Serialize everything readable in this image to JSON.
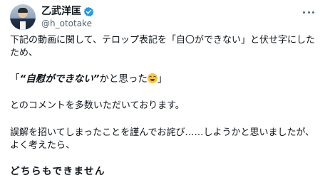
{
  "tweet": {
    "author": {
      "display_name": "乙武洋匡",
      "handle": "@h_ototake",
      "verified": true,
      "verified_color": "#1d9bf0"
    },
    "paragraphs": {
      "p1": "下記の動画に関して、テロップ表記を「自〇ができない」と伏せ字にしたため、",
      "p2_open": "「",
      "p2_bold": "“自慰ができない”",
      "p2_rest": "かと思った",
      "p2_emoji": "joy-emoji",
      "p2_close": "」",
      "p3": "とのコメントを多数いただいております。",
      "p4": "誤解を招いてしまったことを謹んでお詫び……しようかと思いましたが、よく考えたら、",
      "p5": "どちらもできません"
    }
  }
}
